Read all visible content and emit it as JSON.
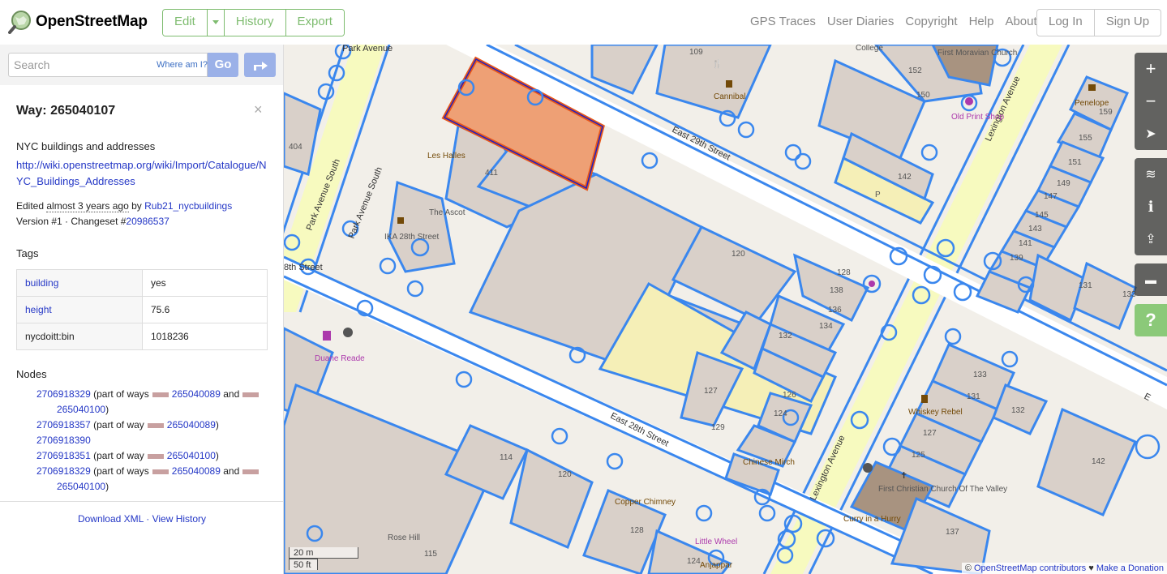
{
  "header": {
    "brand": "OpenStreetMap",
    "edit_label": "Edit",
    "history_label": "History",
    "export_label": "Export",
    "nav": [
      "GPS Traces",
      "User Diaries",
      "Copyright",
      "Help",
      "About"
    ],
    "login_label": "Log In",
    "signup_label": "Sign Up"
  },
  "search": {
    "placeholder": "Search",
    "where_am_i": "Where am I?",
    "go_label": "Go"
  },
  "way": {
    "title": "Way: 265040107",
    "close": "×",
    "comment": "NYC buildings and addresses",
    "wiki_link": "http://wiki.openstreetmap.org/wiki/Import/Catalogue/NYC_Buildings_Addresses",
    "edited_prefix": "Edited",
    "edited_time": "almost 3 years ago",
    "edited_by": "by",
    "edited_user": "Rub21_nycbuildings",
    "version_text": "Version #1 · Changeset #",
    "changeset": "20986537"
  },
  "tags": {
    "heading": "Tags",
    "rows": [
      {
        "key": "building",
        "value": "yes"
      },
      {
        "key": "height",
        "value": "75.6"
      },
      {
        "key": "nycdoitt:bin",
        "value": "1018236"
      }
    ]
  },
  "nodes": {
    "heading": "Nodes",
    "items": [
      {
        "id": "2706918329",
        "prefix": "(part of ways",
        "way1": "265040089",
        "mid": "and",
        "way2": "265040100",
        "suffix": ")"
      },
      {
        "id": "2706918357",
        "prefix": "(part of way",
        "way1": "265040089",
        "mid": "",
        "way2": "",
        "suffix": ")"
      },
      {
        "id": "2706918390",
        "prefix": "",
        "way1": "",
        "mid": "",
        "way2": "",
        "suffix": ""
      },
      {
        "id": "2706918351",
        "prefix": "(part of way",
        "way1": "265040100",
        "mid": "",
        "way2": "",
        "suffix": ")"
      },
      {
        "id": "2706918329",
        "prefix": "(part of ways",
        "way1": "265040089",
        "mid": "and",
        "way2": "265040100",
        "suffix": ")"
      }
    ]
  },
  "footer": {
    "download_xml": "Download XML",
    "separator": "·",
    "view_history": "View History"
  },
  "map": {
    "streets": {
      "east_29th": "East 29th Street",
      "east_28th": "East 28th Street",
      "park_ave_s_1": "Park Avenue South",
      "park_ave_s_2": "Park Avenue South",
      "lexington_1": "Lexington Avenue",
      "lexington_2": "Lexington Avenue",
      "park_avenue_top": "Park Avenue",
      "th_street": "8th Street",
      "e_edge": "E"
    },
    "pois": {
      "les_halles": "Les Halles",
      "the_ascot": "The Ascot",
      "ika_28th": "IKA 28th Street",
      "duane_reade": "Duane Reade",
      "cannibal": "Cannibal",
      "old_print_shop": "Old Print Shop",
      "first_moravian": "First Moravian Church",
      "college": "College",
      "penelope": "Penelope",
      "whiskey_rebel": "Whiskey Rebel",
      "chinese_mirch": "Chinese Mirch",
      "first_christian": "First Christian Church Of The Valley",
      "curry_in_a_hurry": "Curry in a Hurry",
      "copper_chimney": "Copper Chimney",
      "little_wheel": "Little Wheel",
      "anjappar": "Anjappar",
      "rose_hill": "Rose Hill"
    },
    "numbers": {
      "n411": "411",
      "n109": "109",
      "n120a": "120",
      "n152": "152",
      "n150": "150",
      "n142a": "142",
      "n159": "159",
      "n155": "155",
      "n151": "151",
      "n149": "149",
      "n147": "147",
      "n145": "145",
      "n143": "143",
      "n141": "141",
      "n139": "139",
      "n128": "128",
      "n138": "138",
      "n136": "136",
      "n134": "134",
      "n132a": "132",
      "n131a": "131",
      "n133a": "133",
      "n127": "127",
      "n129": "129",
      "n126": "126",
      "n124": "124",
      "n133b": "133",
      "n131b": "131",
      "n127b": "127",
      "n125": "125",
      "n132b": "132",
      "n142b": "142",
      "n137": "137",
      "n114": "114",
      "n120b": "120",
      "n128b": "128",
      "n115": "115",
      "n404": "404",
      "n124b": "124"
    },
    "parking_label": "P",
    "scale_m": "20 m",
    "scale_ft": "50 ft",
    "attribution_prefix": "©",
    "attribution_link": "OpenStreetMap contributors",
    "donate": "Make a Donation",
    "heart": "♥",
    "help_label": "?"
  }
}
